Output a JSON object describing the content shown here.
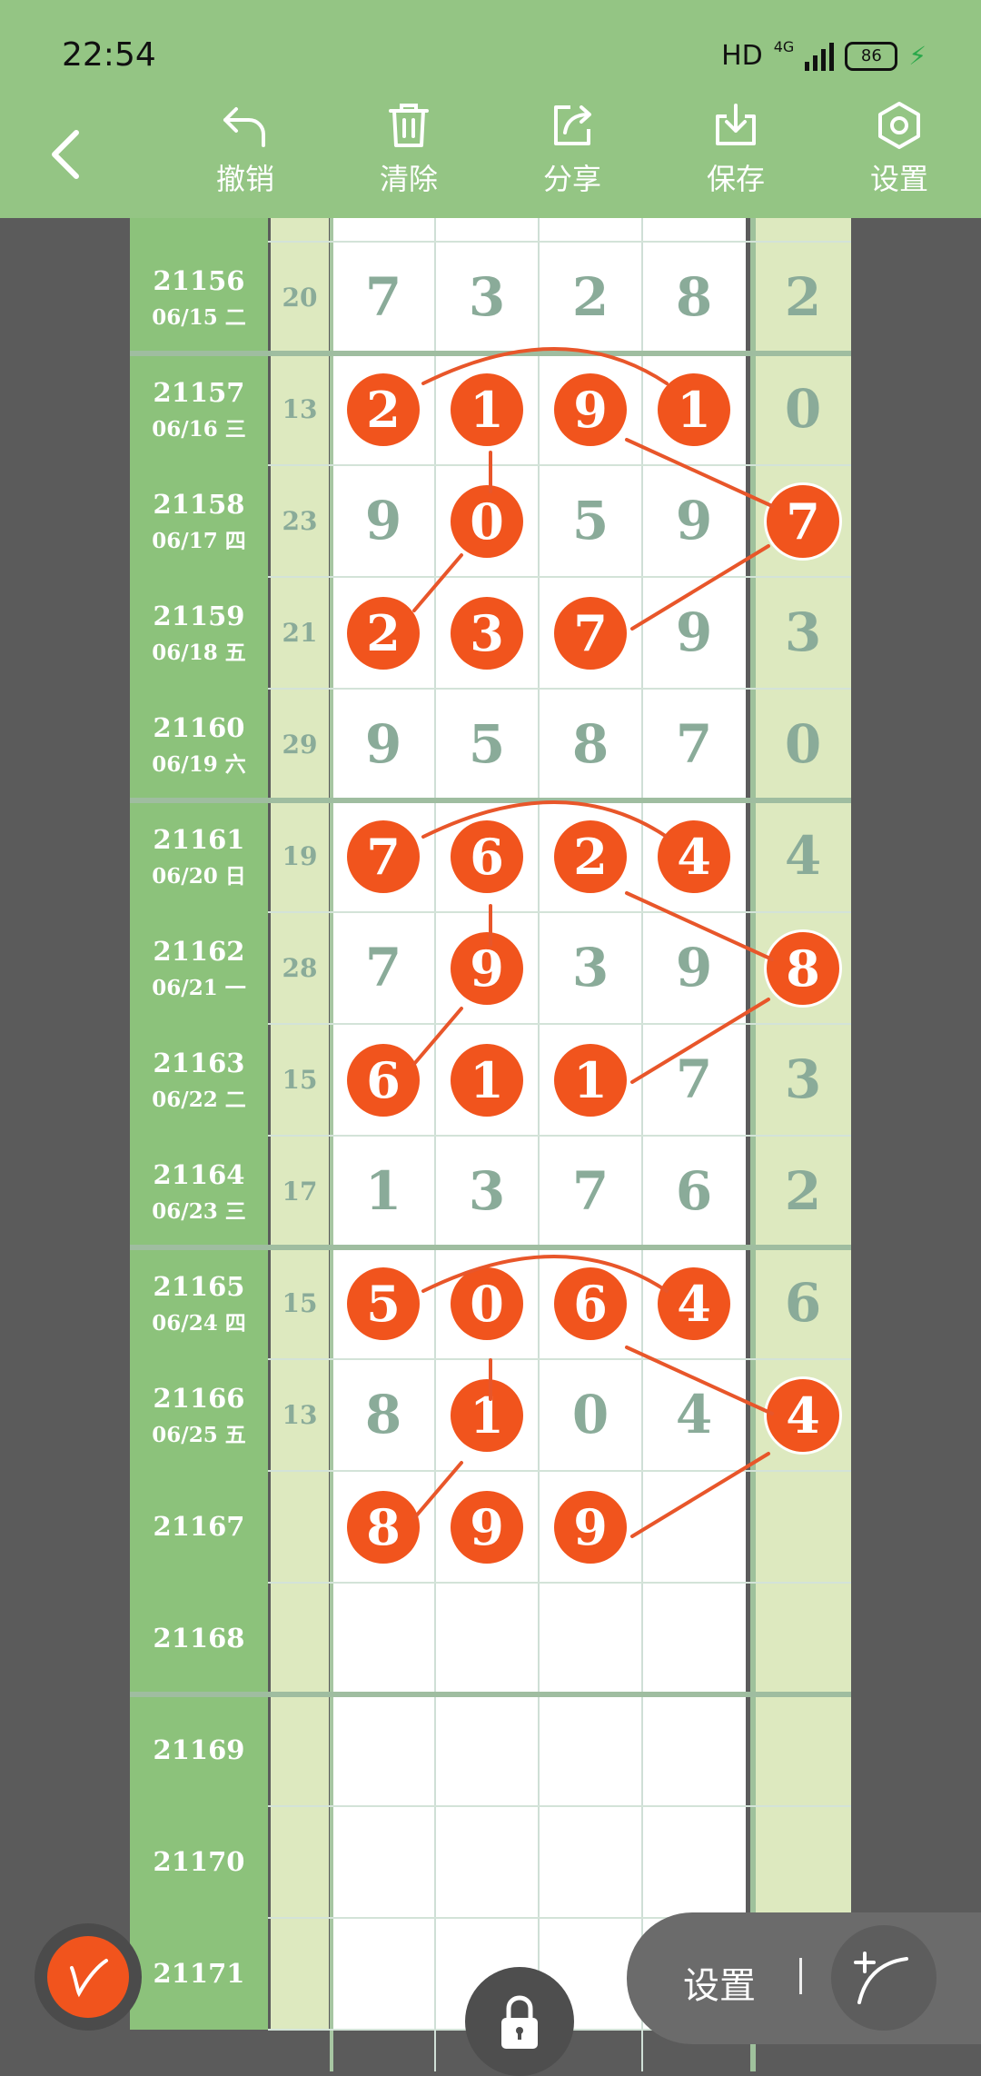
{
  "status_bar": {
    "time": "22:54",
    "hd": "HD",
    "network": "4G",
    "battery": "86"
  },
  "toolbar": {
    "undo": "撤销",
    "clear": "清除",
    "share": "分享",
    "save": "保存",
    "settings": "设置"
  },
  "rows": [
    {
      "id": "",
      "date": "",
      "sum": "",
      "digits": [
        "",
        "",
        "",
        ""
      ],
      "last": "",
      "hl": [],
      "last_hl": false
    },
    {
      "id": "21156",
      "date": "06/15 二",
      "sum": "20",
      "digits": [
        "7",
        "3",
        "2",
        "8"
      ],
      "last": "2",
      "hl": [],
      "last_hl": false
    },
    {
      "id": "21157",
      "date": "06/16 三",
      "sum": "13",
      "digits": [
        "2",
        "1",
        "9",
        "1"
      ],
      "last": "0",
      "hl": [
        0,
        1,
        2,
        3
      ],
      "last_hl": false
    },
    {
      "id": "21158",
      "date": "06/17 四",
      "sum": "23",
      "digits": [
        "9",
        "0",
        "5",
        "9"
      ],
      "last": "7",
      "hl": [
        1
      ],
      "last_hl": true
    },
    {
      "id": "21159",
      "date": "06/18 五",
      "sum": "21",
      "digits": [
        "2",
        "3",
        "7",
        "9"
      ],
      "last": "3",
      "hl": [
        0,
        1,
        2
      ],
      "last_hl": false
    },
    {
      "id": "21160",
      "date": "06/19 六",
      "sum": "29",
      "digits": [
        "9",
        "5",
        "8",
        "7"
      ],
      "last": "0",
      "hl": [],
      "last_hl": false
    },
    {
      "id": "21161",
      "date": "06/20 日",
      "sum": "19",
      "digits": [
        "7",
        "6",
        "2",
        "4"
      ],
      "last": "4",
      "hl": [
        0,
        1,
        2,
        3
      ],
      "last_hl": false
    },
    {
      "id": "21162",
      "date": "06/21 一",
      "sum": "28",
      "digits": [
        "7",
        "9",
        "3",
        "9"
      ],
      "last": "8",
      "hl": [
        1
      ],
      "last_hl": true
    },
    {
      "id": "21163",
      "date": "06/22 二",
      "sum": "15",
      "digits": [
        "6",
        "1",
        "1",
        "7"
      ],
      "last": "3",
      "hl": [
        0,
        1,
        2
      ],
      "last_hl": false
    },
    {
      "id": "21164",
      "date": "06/23 三",
      "sum": "17",
      "digits": [
        "1",
        "3",
        "7",
        "6"
      ],
      "last": "2",
      "hl": [],
      "last_hl": false
    },
    {
      "id": "21165",
      "date": "06/24 四",
      "sum": "15",
      "digits": [
        "5",
        "0",
        "6",
        "4"
      ],
      "last": "6",
      "hl": [
        0,
        1,
        2,
        3
      ],
      "last_hl": false
    },
    {
      "id": "21166",
      "date": "06/25 五",
      "sum": "13",
      "digits": [
        "8",
        "1",
        "0",
        "4"
      ],
      "last": "4",
      "hl": [
        1
      ],
      "last_hl": true
    },
    {
      "id": "21167",
      "date": "",
      "sum": "",
      "digits": [
        "8",
        "9",
        "9",
        ""
      ],
      "last": "",
      "hl": [
        0,
        1,
        2
      ],
      "last_hl": false
    },
    {
      "id": "21168",
      "date": "",
      "sum": "",
      "digits": [
        "",
        "",
        "",
        ""
      ],
      "last": "",
      "hl": [],
      "last_hl": false
    },
    {
      "id": "21169",
      "date": "",
      "sum": "",
      "digits": [
        "",
        "",
        "",
        ""
      ],
      "last": "",
      "hl": [],
      "last_hl": false
    },
    {
      "id": "21170",
      "date": "",
      "sum": "",
      "digits": [
        "",
        "",
        "",
        ""
      ],
      "last": "",
      "hl": [],
      "last_hl": false
    },
    {
      "id": "21171",
      "date": "",
      "sum": "",
      "digits": [
        "",
        "",
        "",
        ""
      ],
      "last": "",
      "hl": [],
      "last_hl": false
    }
  ],
  "float_panel": {
    "settings": "设置"
  },
  "colors": {
    "header_bg": "#94c584",
    "id_col": "#8cc27b",
    "side_col": "#dde9bf",
    "digit": "#8aab99",
    "highlight": "#f1541d",
    "background": "#5b5b5b"
  },
  "icons": [
    "back-arrow-icon",
    "undo-icon",
    "trash-icon",
    "share-icon",
    "download-icon",
    "settings-hex-icon",
    "pen-icon",
    "lock-icon",
    "curve-add-icon"
  ]
}
